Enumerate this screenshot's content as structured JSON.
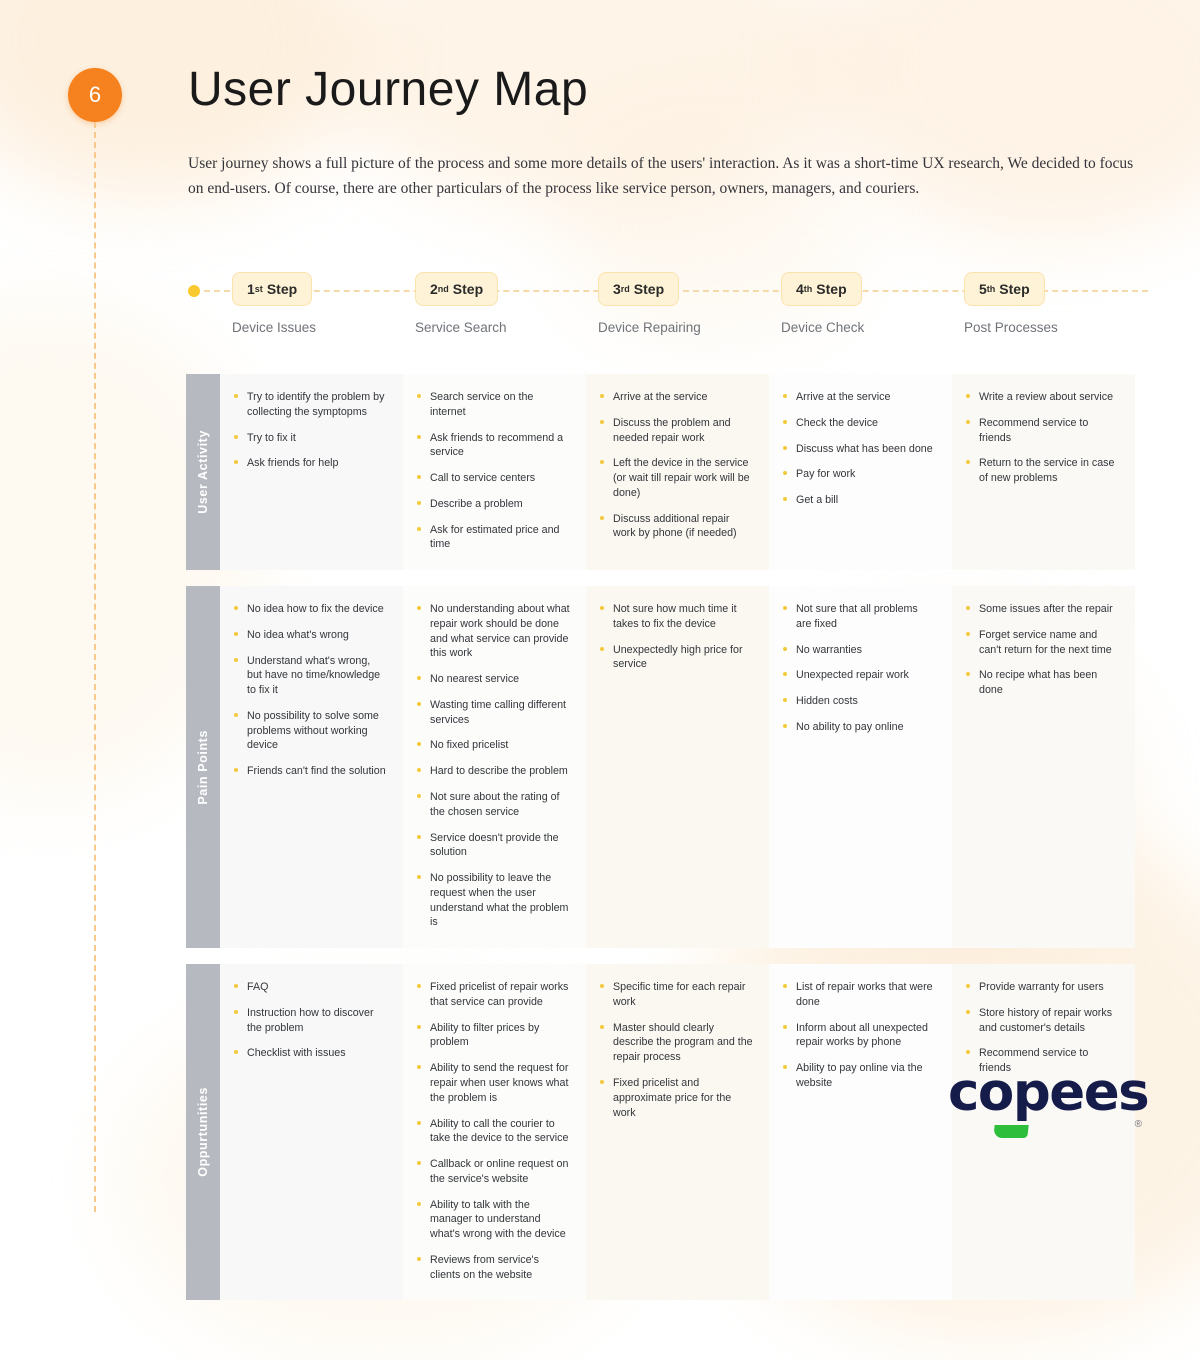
{
  "slide": {
    "number": "6",
    "title": "User Journey Map",
    "intro": "User journey shows a full picture of the process and some more details of the users' interaction. As it was a short-time UX research, We decided to focus on end-users. Of course, there are other particulars of the process like service person, owners, managers, and couriers."
  },
  "colors": {
    "accent_orange": "#F6821F",
    "accent_yellow": "#FAC92F",
    "bullet_yellow": "#F4C93C",
    "chip_bg": "#FEF3D6",
    "chip_border": "#FBE3AE",
    "row_label_gray": "#B6BAC0",
    "logo_navy": "#161C4A",
    "logo_green": "#2DBE3C"
  },
  "steps": [
    {
      "ordinal": "1",
      "suffix": "st",
      "word": "Step",
      "name": "Device Issues"
    },
    {
      "ordinal": "2",
      "suffix": "nd",
      "word": "Step",
      "name": "Service Search"
    },
    {
      "ordinal": "3",
      "suffix": "rd",
      "word": "Step",
      "name": "Device Repairing"
    },
    {
      "ordinal": "4",
      "suffix": "th",
      "word": "Step",
      "name": "Device Check"
    },
    {
      "ordinal": "5",
      "suffix": "th",
      "word": "Step",
      "name": "Post Processes"
    }
  ],
  "rows": [
    {
      "label": "User Activity",
      "columns": [
        [
          "Try to identify the problem by collecting the symptopms",
          "Try to fix it",
          "Ask friends for help"
        ],
        [
          "Search service on the internet",
          "Ask friends to recommend a service",
          "Call to service centers",
          "Describe a problem",
          "Ask for estimated price and time"
        ],
        [
          "Arrive at the service",
          "Discuss the problem and needed repair work",
          "Left the device in the service (or wait till repair work will be done)",
          "Discuss additional repair work by phone (if needed)"
        ],
        [
          "Arrive at the service",
          "Check the device",
          "Discuss what has been done",
          "Pay for work",
          "Get a bill"
        ],
        [
          "Write a review about service",
          "Recommend service to friends",
          "Return to the service in case of new problems"
        ]
      ]
    },
    {
      "label": "Pain Points",
      "columns": [
        [
          "No idea how to fix the device",
          "No idea what's wrong",
          "Understand what's wrong, but have no time/knowledge to fix it",
          "No possibility to solve some problems without working device",
          "Friends can't find the solution"
        ],
        [
          "No understanding about what repair work should be done and what service can provide this work",
          "No nearest service",
          "Wasting time calling different services",
          "No fixed pricelist",
          "Hard to describe the problem",
          "Not sure about the rating of the chosen service",
          "Service doesn't provide the solution",
          "No possibility to leave the request when the user understand what the problem is"
        ],
        [
          "Not sure how much time it takes to fix the device",
          "Unexpectedly high price for service"
        ],
        [
          "Not sure that all problems are fixed",
          "No warranties",
          "Unexpected repair work",
          "Hidden costs",
          "No ability to pay online"
        ],
        [
          "Some issues after the repair",
          "Forget service name and can't return for the next time",
          "No recipe what has been done"
        ]
      ]
    },
    {
      "label": "Oppurtunities",
      "columns": [
        [
          "FAQ",
          "Instruction how to discover the problem",
          "Checklist with issues"
        ],
        [
          "Fixed pricelist of repair works that service can provide",
          "Ability to filter prices by problem",
          "Ability to send the request for repair when user knows what the problem is",
          "Ability to call the courier to take the device to the service",
          "Callback or online request on the service's website",
          "Ability to talk with the manager to understand what's wrong with the device",
          "Reviews from service's clients on the website"
        ],
        [
          "Specific time for each repair work",
          "Master should clearly describe the program and the repair process",
          "Fixed pricelist and approximate price for the work"
        ],
        [
          "List of repair works that were done",
          "Inform about all unexpected repair works by phone",
          "Ability to pay online via the website"
        ],
        [
          "Provide warranty for users",
          "Store history of repair works and customer's details",
          "Recommend service to friends"
        ]
      ]
    }
  ],
  "logo": {
    "word": "copees",
    "registered": "®"
  }
}
